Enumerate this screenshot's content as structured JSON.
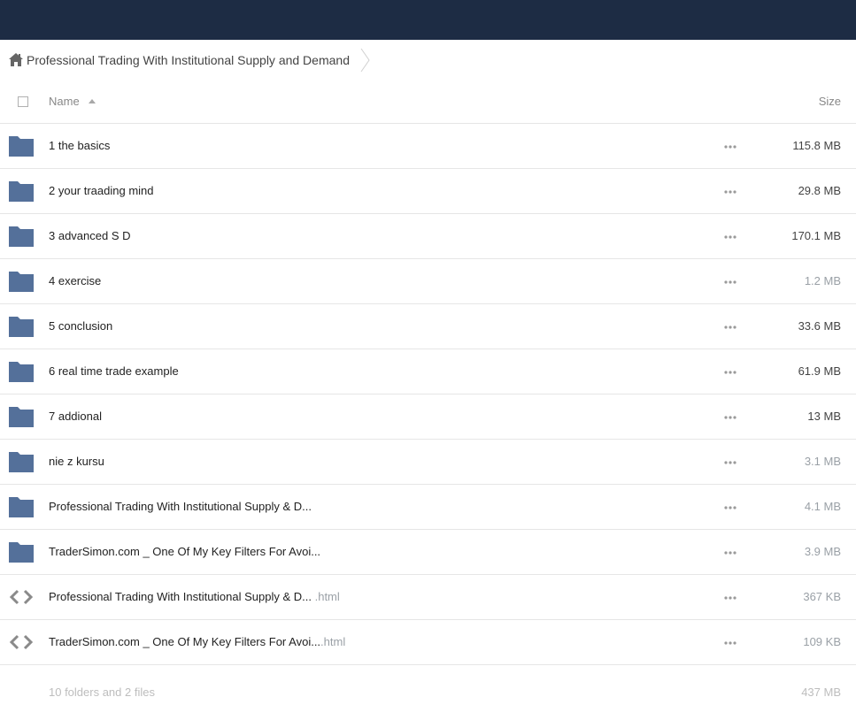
{
  "breadcrumb": {
    "home_icon": "home-icon",
    "title": "Professional Trading With Institutional Supply and Demand"
  },
  "header": {
    "name_label": "Name",
    "size_label": "Size"
  },
  "colors": {
    "topbar": "#1d2c44",
    "folder": "#54709a",
    "code_icon": "#8a8a8a"
  },
  "items": [
    {
      "type": "folder",
      "name": "1 the basics",
      "ext": "",
      "size": "115.8 MB",
      "size_color": "#444444"
    },
    {
      "type": "folder",
      "name": "2 your traading mind",
      "ext": "",
      "size": "29.8 MB",
      "size_color": "#444444"
    },
    {
      "type": "folder",
      "name": "3 advanced S D",
      "ext": "",
      "size": "170.1 MB",
      "size_color": "#444444"
    },
    {
      "type": "folder",
      "name": "4 exercise",
      "ext": "",
      "size": "1.2 MB",
      "size_color": "#9aa0a6"
    },
    {
      "type": "folder",
      "name": "5 conclusion",
      "ext": "",
      "size": "33.6 MB",
      "size_color": "#444444"
    },
    {
      "type": "folder",
      "name": "6 real time trade example",
      "ext": "",
      "size": "61.9 MB",
      "size_color": "#444444"
    },
    {
      "type": "folder",
      "name": "7 addional",
      "ext": "",
      "size": "13 MB",
      "size_color": "#444444"
    },
    {
      "type": "folder",
      "name": "nie z kursu",
      "ext": "",
      "size": "3.1 MB",
      "size_color": "#9aa0a6"
    },
    {
      "type": "folder",
      "name": "Professional Trading With Institutional Supply & D...",
      "ext": "",
      "size": "4.1 MB",
      "size_color": "#9aa0a6"
    },
    {
      "type": "folder",
      "name": "TraderSimon.com _ One Of My Key Filters For Avoi...",
      "ext": "",
      "size": "3.9 MB",
      "size_color": "#9aa0a6"
    },
    {
      "type": "file",
      "name": "Professional Trading With Institutional Supply & D...",
      "ext": " .html",
      "size": "367 KB",
      "size_color": "#9aa0a6"
    },
    {
      "type": "file",
      "name": "TraderSimon.com _ One Of My Key Filters For Avoi...",
      "ext": ".html",
      "size": "109 KB",
      "size_color": "#9aa0a6"
    }
  ],
  "footer": {
    "summary": "10 folders and 2 files",
    "total": "437 MB"
  }
}
